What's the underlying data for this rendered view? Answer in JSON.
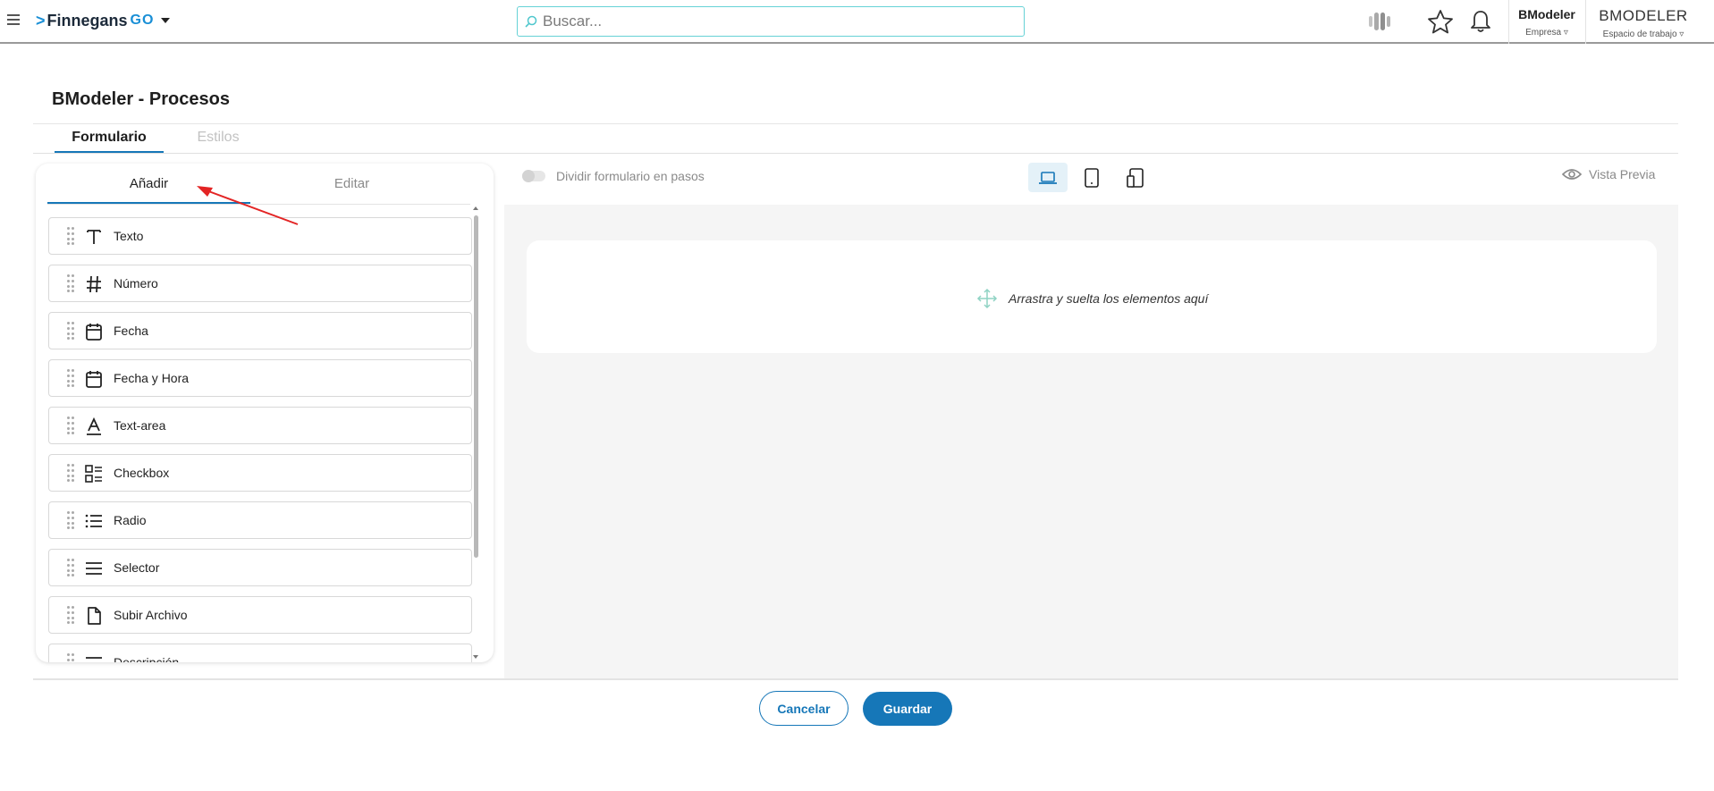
{
  "header": {
    "logo_text": "Finnegans",
    "logo_suffix": "GO",
    "search_placeholder": "Buscar...",
    "company": {
      "name": "BModeler",
      "label": "Empresa"
    },
    "workspace": {
      "name": "BMODELER",
      "label": "Espacio de trabajo"
    }
  },
  "page": {
    "title": "BModeler - Procesos",
    "tabs": [
      {
        "label": "Formulario",
        "active": true
      },
      {
        "label": "Estilos",
        "active": false
      }
    ]
  },
  "panel": {
    "tabs": [
      {
        "label": "Añadir",
        "active": true
      },
      {
        "label": "Editar",
        "active": false
      }
    ],
    "items": [
      {
        "label": "Texto",
        "icon": "text-icon"
      },
      {
        "label": "Número",
        "icon": "hash-icon"
      },
      {
        "label": "Fecha",
        "icon": "calendar-icon"
      },
      {
        "label": "Fecha y Hora",
        "icon": "calendar-icon"
      },
      {
        "label": "Text-area",
        "icon": "text-area-icon"
      },
      {
        "label": "Checkbox",
        "icon": "checklist-icon"
      },
      {
        "label": "Radio",
        "icon": "list-icon"
      },
      {
        "label": "Selector",
        "icon": "menu-lines-icon"
      },
      {
        "label": "Subir Archivo",
        "icon": "file-icon"
      },
      {
        "label": "Descripción",
        "icon": "description-icon"
      }
    ]
  },
  "builder": {
    "split_label": "Dividir formulario en pasos",
    "preview_label": "Vista Previa",
    "devices": [
      "laptop-icon",
      "tablet-icon",
      "responsive-icon"
    ],
    "dropzone_text": "Arrastra y suelta los elementos aquí"
  },
  "footer": {
    "cancel_label": "Cancelar",
    "save_label": "Guardar"
  },
  "colors": {
    "accent": "#1677b8",
    "search_border": "#66d2d6",
    "annotation": "#e32424"
  }
}
